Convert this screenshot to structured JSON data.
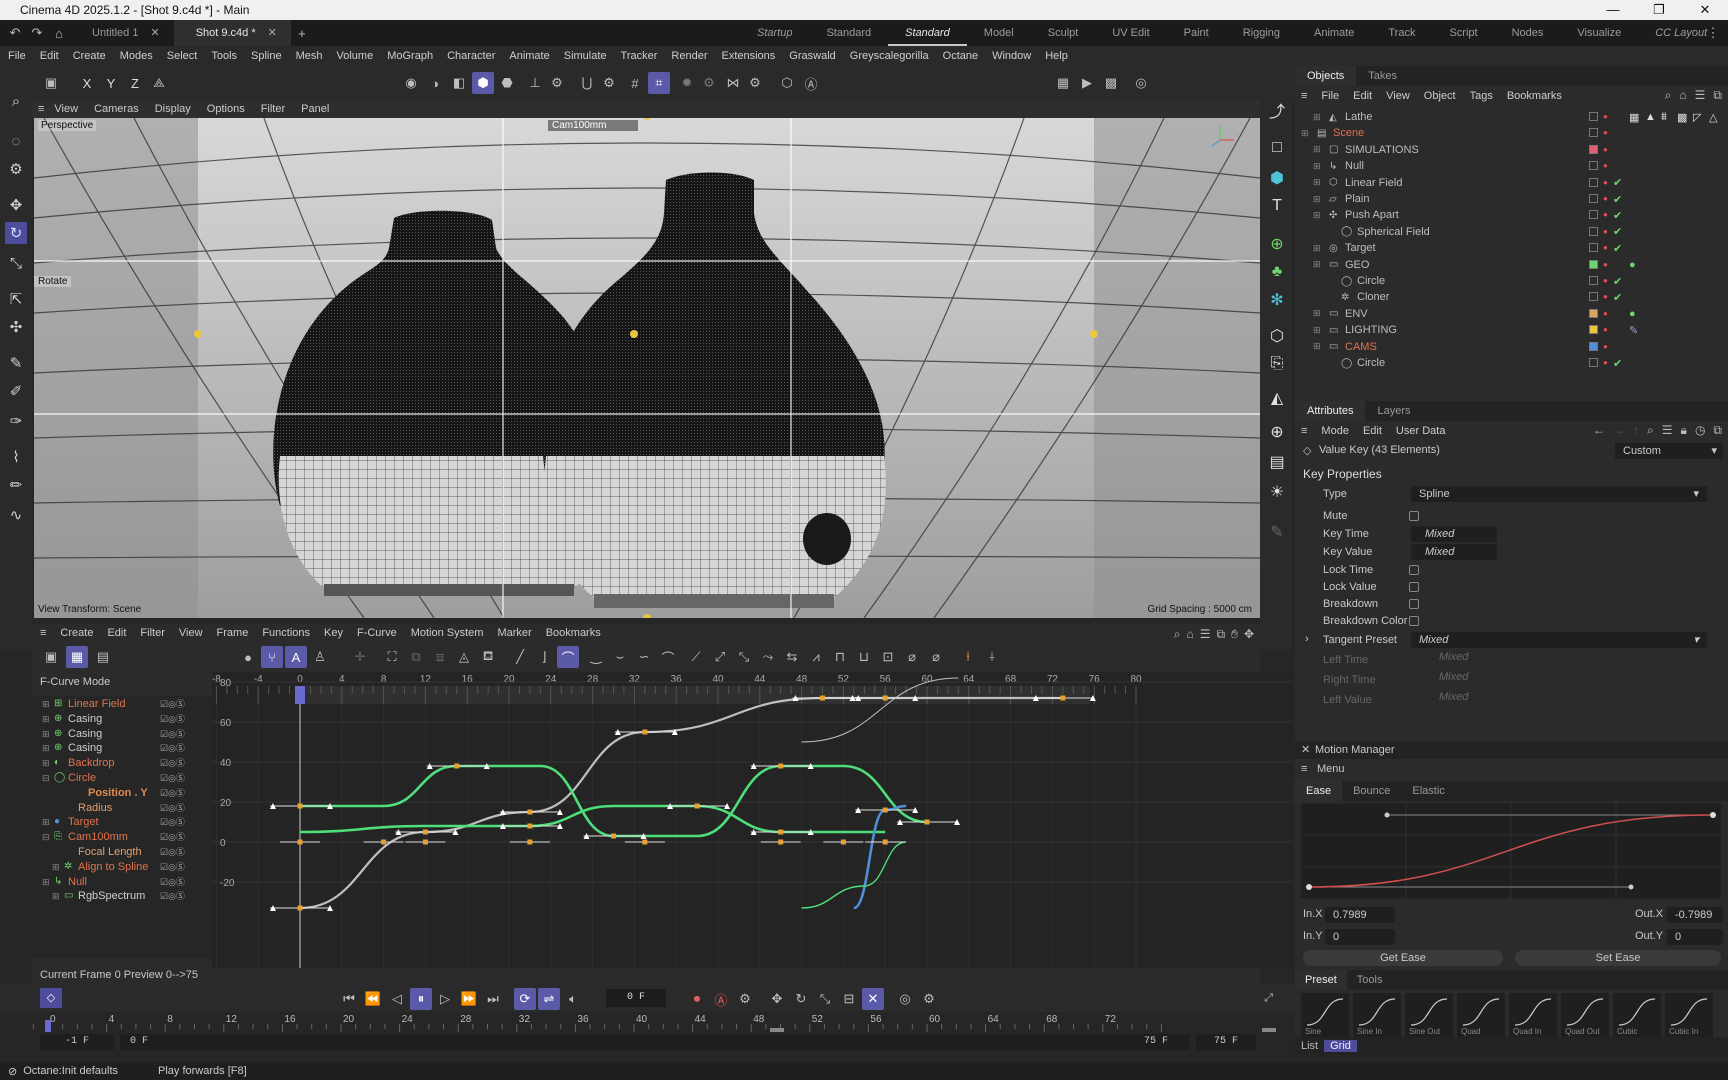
{
  "window": {
    "title": "Cinema 4D 2025.1.2 - [Shot 9.c4d *] - Main",
    "minimize": "—",
    "maximize": "❐",
    "close": "✕"
  },
  "doc_tabs": [
    {
      "label": "Untitled 1"
    },
    {
      "label": "Shot 9.c4d *"
    }
  ],
  "layouts": [
    "Startup",
    "Standard",
    "Standard",
    "Model",
    "Sculpt",
    "UV Edit",
    "Paint",
    "Rigging",
    "Animate",
    "Track",
    "Script",
    "Nodes",
    "Visualize",
    "CC Layout"
  ],
  "menu": [
    "File",
    "Edit",
    "Create",
    "Modes",
    "Select",
    "Tools",
    "Spline",
    "Mesh",
    "Volume",
    "MoGraph",
    "Character",
    "Animate",
    "Simulate",
    "Tracker",
    "Render",
    "Extensions",
    "Graswald",
    "Greyscalegorilla",
    "Octane",
    "Window",
    "Help"
  ],
  "viewport": {
    "menu": [
      "View",
      "Cameras",
      "Display",
      "Options",
      "Filter",
      "Panel"
    ],
    "perspective": "Perspective",
    "camera": "Cam100mm",
    "tool_label": "Rotate",
    "view_transform": "View Transform: Scene",
    "grid_spacing": "Grid Spacing : 5000 cm"
  },
  "toolbar": {
    "axis_x": "X",
    "axis_y": "Y",
    "axis_z": "Z"
  },
  "objects": {
    "tabs": [
      "Objects",
      "Takes"
    ],
    "menu": [
      "File",
      "Edit",
      "View",
      "Object",
      "Tags",
      "Bookmarks"
    ],
    "rows": [
      {
        "name": "Lathe",
        "indent": 1,
        "color": "#bdbdbd"
      },
      {
        "name": "Scene",
        "indent": 0,
        "color": "#e0734f"
      },
      {
        "name": "SIMULATIONS",
        "indent": 1,
        "color": "#bdbdbd"
      },
      {
        "name": "Null",
        "indent": 1,
        "color": "#bdbdbd"
      },
      {
        "name": "Linear Field",
        "indent": 1,
        "color": "#bdbdbd"
      },
      {
        "name": "Plain",
        "indent": 1,
        "color": "#bdbdbd"
      },
      {
        "name": "Push Apart",
        "indent": 1,
        "color": "#bdbdbd"
      },
      {
        "name": "Spherical Field",
        "indent": 2,
        "color": "#bdbdbd"
      },
      {
        "name": "Target",
        "indent": 1,
        "color": "#bdbdbd"
      },
      {
        "name": "GEO",
        "indent": 1,
        "color": "#bdbdbd"
      },
      {
        "name": "Circle",
        "indent": 2,
        "color": "#bdbdbd"
      },
      {
        "name": "Cloner",
        "indent": 2,
        "color": "#bdbdbd"
      },
      {
        "name": "ENV",
        "indent": 1,
        "color": "#bdbdbd"
      },
      {
        "name": "LIGHTING",
        "indent": 1,
        "color": "#bdbdbd"
      },
      {
        "name": "CAMS",
        "indent": 1,
        "color": "#e0734f"
      },
      {
        "name": "Circle",
        "indent": 2,
        "color": "#bdbdbd"
      }
    ]
  },
  "attributes": {
    "tabs": [
      "Attributes",
      "Layers"
    ],
    "menu": [
      "Mode",
      "Edit",
      "User Data"
    ],
    "header": "Value Key (43 Elements)",
    "preset": "Custom",
    "section": "Key Properties",
    "type_label": "Type",
    "type_value": "Spline",
    "mute": "Mute",
    "key_time": "Key Time",
    "key_time_value": "Mixed",
    "key_value": "Key Value",
    "key_value_value": "Mixed",
    "lock_time": "Lock Time",
    "lock_value": "Lock Value",
    "breakdown": "Breakdown",
    "breakdown_color": "Breakdown Color",
    "tangent_preset": "Tangent Preset",
    "tangent_value": "Mixed",
    "left_time": "Left Time",
    "right_time": "Right Time",
    "left_value": "Left Value",
    "mixed": "Mixed"
  },
  "motion": {
    "title": "Motion Manager",
    "menu": "Menu",
    "tabs": [
      "Ease",
      "Bounce",
      "Elastic"
    ],
    "inx_label": "In.X",
    "inx": "0.7989",
    "iny_label": "In.Y",
    "iny": "0",
    "outx_label": "Out.X",
    "outx": "-0.7989",
    "outy_label": "Out.Y",
    "outy": "0",
    "get_ease": "Get Ease",
    "set_ease": "Set Ease",
    "preset_tabs": [
      "Preset",
      "Tools"
    ],
    "presets": [
      "Sine",
      "Sine In",
      "Sine Out",
      "Quad",
      "Quad In",
      "Quad Out",
      "Cubic",
      "Cubic In"
    ],
    "list": "List",
    "grid": "Grid"
  },
  "timeline": {
    "menu": [
      "Create",
      "Edit",
      "Filter",
      "View",
      "Frame",
      "Functions",
      "Key",
      "F-Curve",
      "Motion System",
      "Marker",
      "Bookmarks"
    ],
    "mode": "F-Curve Mode",
    "ruler": [
      "-8",
      "-4",
      "0",
      "4",
      "8",
      "12",
      "16",
      "20",
      "24",
      "28",
      "32",
      "36",
      "40",
      "44",
      "48",
      "52",
      "56",
      "60",
      "64",
      "68",
      "72",
      "76",
      "80"
    ],
    "value_ticks": [
      "80",
      "60",
      "40",
      "20",
      "0",
      "-20"
    ],
    "tracks": [
      {
        "name": "Linear Field",
        "color": "#e0734f",
        "indent": 0,
        "exp": "+"
      },
      {
        "name": "Casing",
        "color": "#cfcfcf",
        "indent": 0,
        "exp": "+"
      },
      {
        "name": "Casing",
        "color": "#cfcfcf",
        "indent": 0,
        "exp": "+"
      },
      {
        "name": "Casing",
        "color": "#cfcfcf",
        "indent": 0,
        "exp": "+"
      },
      {
        "name": "Backdrop",
        "color": "#e0734f",
        "indent": 0,
        "exp": "+"
      },
      {
        "name": "Circle",
        "color": "#e0734f",
        "indent": 0,
        "exp": "−"
      },
      {
        "name": "Position . Y",
        "color": "#e08a4f",
        "indent": 2,
        "exp": ""
      },
      {
        "name": "Radius",
        "color": "#e0a070",
        "indent": 1,
        "exp": ""
      },
      {
        "name": "Target",
        "color": "#e0734f",
        "indent": 0,
        "exp": "+"
      },
      {
        "name": "Cam100mm",
        "color": "#e0734f",
        "indent": 0,
        "exp": "−"
      },
      {
        "name": "Focal Length",
        "color": "#e0a070",
        "indent": 1,
        "exp": ""
      },
      {
        "name": "Align to Spline",
        "color": "#e0734f",
        "indent": 1,
        "exp": "+"
      },
      {
        "name": "Null",
        "color": "#e0734f",
        "indent": 0,
        "exp": "+"
      },
      {
        "name": "RgbSpectrum",
        "color": "#cfcfcf",
        "indent": 1,
        "exp": "+"
      }
    ],
    "current_frame": "Current Frame  0  Preview  0-->75"
  },
  "transport": {
    "frame": "0 F"
  },
  "scrub": {
    "ticks": [
      "0",
      "4",
      "8",
      "12",
      "16",
      "20",
      "24",
      "28",
      "32",
      "36",
      "40",
      "44",
      "48",
      "52",
      "56",
      "60",
      "64",
      "68",
      "72"
    ],
    "start": "-1 F",
    "cur": "0 F",
    "end": "75 F",
    "end2": "75 F"
  },
  "status": {
    "left": "Octane:Init defaults",
    "right": "Play forwards [F8]"
  }
}
